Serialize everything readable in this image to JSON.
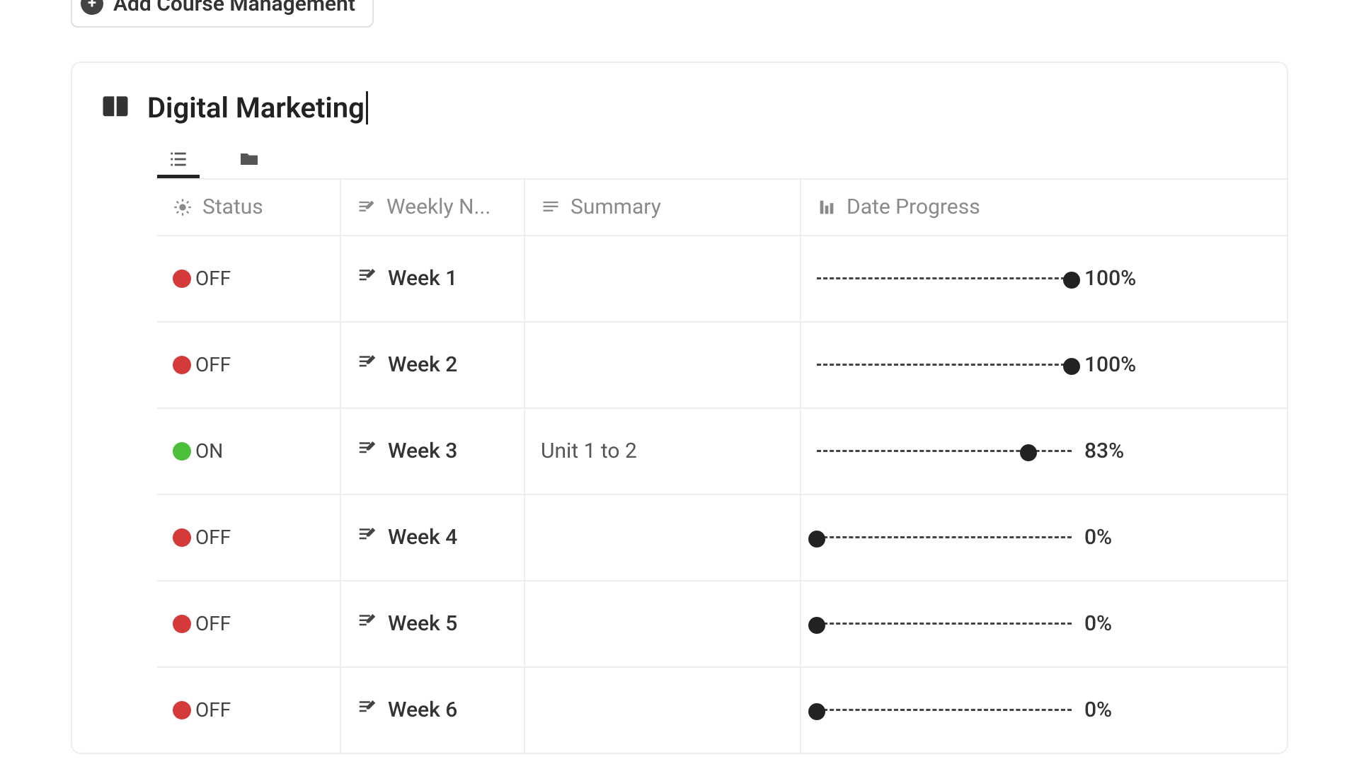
{
  "top_button_label": "Add Course Management",
  "card_title": "Digital Marketing",
  "columns": {
    "status": "Status",
    "weekly": "Weekly N...",
    "summary": "Summary",
    "progress": "Date Progress"
  },
  "rows": [
    {
      "status": "OFF",
      "status_kind": "off",
      "week": "Week 1",
      "summary": "",
      "pct": 100
    },
    {
      "status": "OFF",
      "status_kind": "off",
      "week": "Week 2",
      "summary": "",
      "pct": 100
    },
    {
      "status": "ON",
      "status_kind": "on",
      "week": "Week 3",
      "summary": "Unit 1 to 2",
      "pct": 83
    },
    {
      "status": "OFF",
      "status_kind": "off",
      "week": "Week 4",
      "summary": "",
      "pct": 0
    },
    {
      "status": "OFF",
      "status_kind": "off",
      "week": "Week 5",
      "summary": "",
      "pct": 0
    },
    {
      "status": "OFF",
      "status_kind": "off",
      "week": "Week 6",
      "summary": "",
      "pct": 0
    }
  ]
}
